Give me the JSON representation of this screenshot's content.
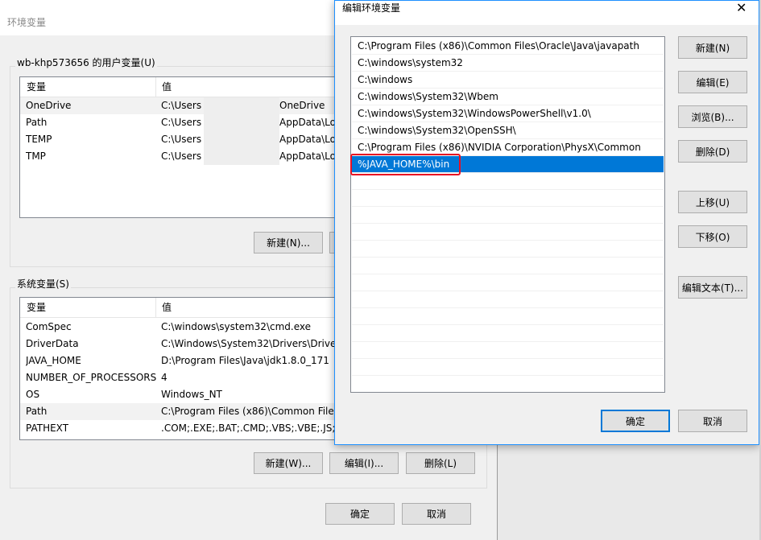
{
  "env_window": {
    "title": "环境变量",
    "user_group_label": "wb-khp573656 的用户变量(U)",
    "col_variable": "变量",
    "col_value": "值",
    "user_vars": [
      {
        "name": "OneDrive",
        "value_prefix": "C:\\Users",
        "value_suffix": "OneDrive"
      },
      {
        "name": "Path",
        "value_prefix": "C:\\Users",
        "value_suffix": "AppData\\Lo"
      },
      {
        "name": "TEMP",
        "value_prefix": "C:\\Users",
        "value_suffix": "AppData\\Lo"
      },
      {
        "name": "TMP",
        "value_prefix": "C:\\Users",
        "value_suffix": "AppData\\Lo"
      }
    ],
    "user_new_button": "新建(N)...",
    "system_group_label": "系统变量(S)",
    "system_vars": [
      {
        "name": "ComSpec",
        "value": "C:\\windows\\system32\\cmd.exe"
      },
      {
        "name": "DriverData",
        "value": "C:\\Windows\\System32\\Drivers\\Driver"
      },
      {
        "name": "JAVA_HOME",
        "value": "D:\\Program Files\\Java\\jdk1.8.0_171"
      },
      {
        "name": "NUMBER_OF_PROCESSORS",
        "value": "4"
      },
      {
        "name": "OS",
        "value": "Windows_NT"
      },
      {
        "name": "Path",
        "value": "C:\\Program Files (x86)\\Common Files"
      },
      {
        "name": "PATHEXT",
        "value": ".COM;.EXE;.BAT;.CMD;.VBS;.VBE;.JS;.JS"
      }
    ],
    "sys_new_button": "新建(W)...",
    "sys_edit_button": "编辑(I)...",
    "sys_delete_button": "删除(L)",
    "ok_button": "确定",
    "cancel_button": "取消"
  },
  "edit_dialog": {
    "title": "编辑环境变量",
    "close_glyph": "✕",
    "paths": [
      "C:\\Program Files (x86)\\Common Files\\Oracle\\Java\\javapath",
      "C:\\windows\\system32",
      "C:\\windows",
      "C:\\windows\\System32\\Wbem",
      "C:\\windows\\System32\\WindowsPowerShell\\v1.0\\",
      "C:\\windows\\System32\\OpenSSH\\",
      "C:\\Program Files (x86)\\NVIDIA Corporation\\PhysX\\Common",
      "%JAVA_HOME%\\bin"
    ],
    "selected_index": 7,
    "new_button": "新建(N)",
    "edit_button": "编辑(E)",
    "browse_button": "浏览(B)...",
    "delete_button": "删除(D)",
    "move_up_button": "上移(U)",
    "move_down_button": "下移(O)",
    "edit_text_button": "编辑文本(T)...",
    "ok_button": "确定",
    "cancel_button": "取消"
  },
  "colors": {
    "selection": "#0078d7",
    "highlight_box": "#e81123",
    "dialog_border": "#1e90ff"
  }
}
